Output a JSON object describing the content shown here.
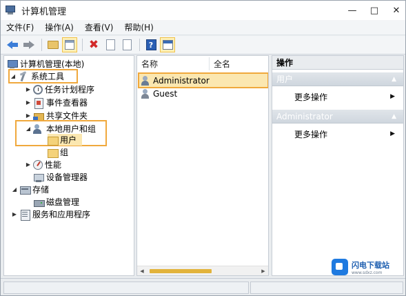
{
  "window": {
    "title": "计算机管理",
    "controls": [
      "—",
      "□",
      "✕"
    ]
  },
  "menu": [
    "文件(F)",
    "操作(A)",
    "查看(V)",
    "帮助(H)"
  ],
  "toolbar": {
    "buttons": [
      "back-icon",
      "forward-icon",
      "up-folder-icon",
      "show-hide-tree-icon",
      "delete-icon",
      "properties-icon",
      "export-icon",
      "help-icon",
      "show-hide-action-pane-icon"
    ]
  },
  "tree": {
    "root": "计算机管理(本地)",
    "system_tools": "系统工具",
    "task_scheduler": "任务计划程序",
    "event_viewer": "事件查看器",
    "shared_folders": "共享文件夹",
    "local_users_groups": "本地用户和组",
    "users": "用户",
    "groups": "组",
    "performance": "性能",
    "device_manager": "设备管理器",
    "storage": "存储",
    "disk_management": "磁盘管理",
    "services_apps": "服务和应用程序"
  },
  "list": {
    "columns": [
      "名称",
      "全名"
    ],
    "rows": [
      {
        "name": "Administrator",
        "full_name": ""
      },
      {
        "name": "Guest",
        "full_name": ""
      }
    ]
  },
  "actions": {
    "header": "操作",
    "section1": "用户",
    "section1_item": "更多操作",
    "section2": "Administrator",
    "section2_item": "更多操作"
  },
  "watermark": {
    "name": "闪电下载站",
    "url": "www.sdxz.com"
  },
  "colors": {
    "highlight": "#f0a83c",
    "selection": "#fbe7b0"
  }
}
